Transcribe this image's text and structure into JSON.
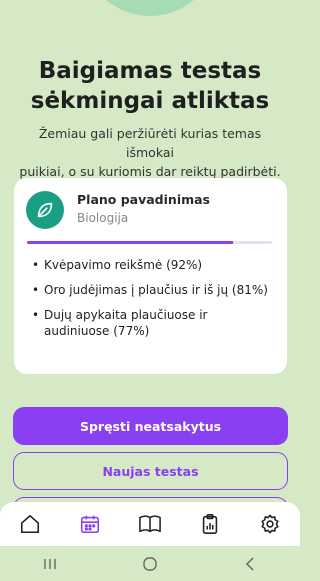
{
  "header": {
    "title_line1": "Baigiamas testas",
    "title_line2": "sėkmingai atliktas",
    "subtitle_line1": "Žemiau gali peržiūrėti kurias temas išmokai",
    "subtitle_line2": "puikiai, o su kuriomis dar reiktų padirbėti."
  },
  "card": {
    "plan_name": "Plano pavadinimas",
    "subject": "Biologija",
    "progress_fraction": 0.84,
    "icon": "leaf-icon",
    "topics": [
      "Kvėpavimo reikšmė (92%)",
      "Oro judėjimas į plaučius ir iš jų (81%)",
      "Dujų apykaita plaučiuose ir audiniuose (77%)"
    ]
  },
  "actions": {
    "primary_label": "Spręsti neatsakytus",
    "secondary_label": "Naujas testas"
  },
  "bottom_nav": {
    "items": [
      "home-icon",
      "calendar-icon",
      "book-icon",
      "clipboard-chart-icon",
      "settings-icon"
    ],
    "active": "calendar-icon"
  },
  "system_nav": [
    "recent-apps-icon",
    "home-circle-icon",
    "back-icon"
  ],
  "colors": {
    "background": "#d6e9c6",
    "accent": "#8a3ff2",
    "icon_teal": "#1a9e84"
  }
}
